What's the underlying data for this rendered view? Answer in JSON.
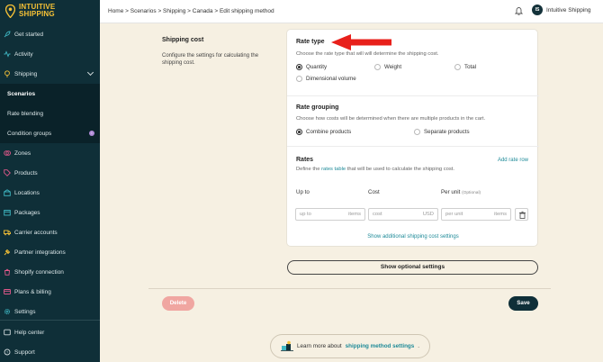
{
  "brand": {
    "line1": "INTUITIVE",
    "line2": "SHIPPING"
  },
  "sidebar": {
    "items": [
      {
        "label": "Get started",
        "icon": "rocket-icon"
      },
      {
        "label": "Activity",
        "icon": "activity-icon"
      },
      {
        "label": "Shipping",
        "icon": "bulb-icon"
      },
      {
        "label": "Scenarios"
      },
      {
        "label": "Rate blending"
      },
      {
        "label": "Condition groups"
      },
      {
        "label": "Zones",
        "icon": "zones-icon"
      },
      {
        "label": "Products",
        "icon": "tag-icon"
      },
      {
        "label": "Locations",
        "icon": "location-icon"
      },
      {
        "label": "Packages",
        "icon": "package-icon"
      },
      {
        "label": "Carrier accounts",
        "icon": "truck-icon"
      },
      {
        "label": "Partner integrations",
        "icon": "plug-icon"
      },
      {
        "label": "Shopify connection",
        "icon": "shopify-icon"
      },
      {
        "label": "Plans & billing",
        "icon": "card-icon"
      },
      {
        "label": "Settings",
        "icon": "gear-icon"
      },
      {
        "label": "Help center",
        "icon": "help-icon"
      },
      {
        "label": "Support",
        "icon": "support-icon"
      }
    ]
  },
  "topbar": {
    "breadcrumb": "Home > Scenarios > Shipping > Canada > Edit shipping method",
    "avatar_initials": "IS",
    "username": "Intuitive Shipping"
  },
  "section": {
    "title": "Shipping cost",
    "description": "Configure the settings for calculating the shipping cost."
  },
  "rate_type": {
    "title": "Rate type",
    "subtitle": "Choose the rate type that will will determine the shipping cost.",
    "options": [
      "Quantity",
      "Weight",
      "Total",
      "Dimensional volume"
    ],
    "selected": "Quantity"
  },
  "rate_grouping": {
    "title": "Rate grouping",
    "subtitle": "Choose how costs will be determined when there are multiple products in the cart.",
    "options": [
      "Combine products",
      "Separate products"
    ],
    "selected": "Combine products"
  },
  "rates": {
    "title": "Rates",
    "add_link": "Add rate row",
    "desc_before": "Define the",
    "desc_link": "rates table",
    "desc_after": "that will be used to calculate the shipping cost.",
    "col_upto": "Up to",
    "col_cost": "Cost",
    "col_perunit": "Per unit",
    "col_optional": "(Optional)",
    "upto_placeholder": "up to",
    "upto_suffix": "items",
    "cost_placeholder": "cost",
    "cost_suffix": "USD",
    "perunit_placeholder": "per unit",
    "perunit_suffix": "items",
    "show_additional": "Show additional shipping cost settings"
  },
  "buttons": {
    "optional": "Show optional settings",
    "delete": "Delete",
    "save": "Save"
  },
  "learn": {
    "before": "Learn more about",
    "link": "shipping method settings",
    "after": "."
  },
  "colors": {
    "sidebar_bg": "#0f2f38",
    "brand_yellow": "#f7c236",
    "link_teal": "#1e8a98",
    "annotation_red": "#e8201b",
    "delete_pink": "#f0a6a1"
  }
}
